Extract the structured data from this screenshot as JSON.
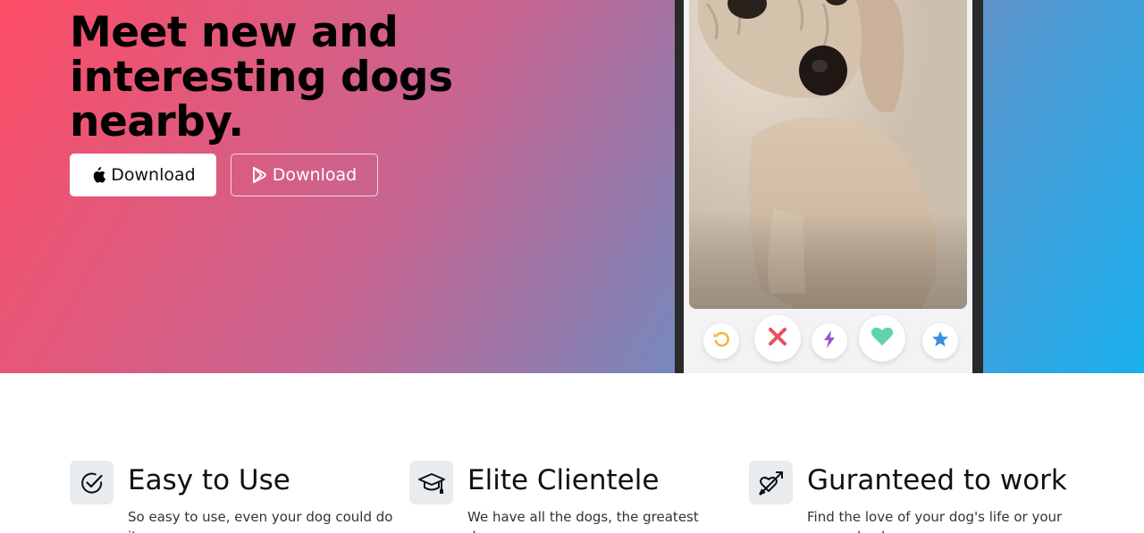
{
  "hero": {
    "title": "Meet new and interesting dogs nearby.",
    "apple_button_label": "Download",
    "play_button_label": "Download"
  },
  "phone": {
    "actions": [
      "rewind-icon",
      "nope-icon",
      "boost-icon",
      "like-icon",
      "super-like-icon"
    ],
    "action_colors": {
      "rewind": "#f5b748",
      "nope": "#e84f5e",
      "boost": "#9b59d0",
      "like": "#5fd4a8",
      "super_like": "#3a8de0"
    }
  },
  "features": [
    {
      "icon": "check-circle-icon",
      "title": "Easy to Use",
      "text": "So easy to use, even your dog could do it."
    },
    {
      "icon": "graduation-cap-icon",
      "title": "Elite Clientele",
      "text": "We have all the dogs, the greatest dogs."
    },
    {
      "icon": "heart-arrow-icon",
      "title": "Guranteed to work",
      "text": "Find the love of your dog's life or your money back."
    }
  ]
}
